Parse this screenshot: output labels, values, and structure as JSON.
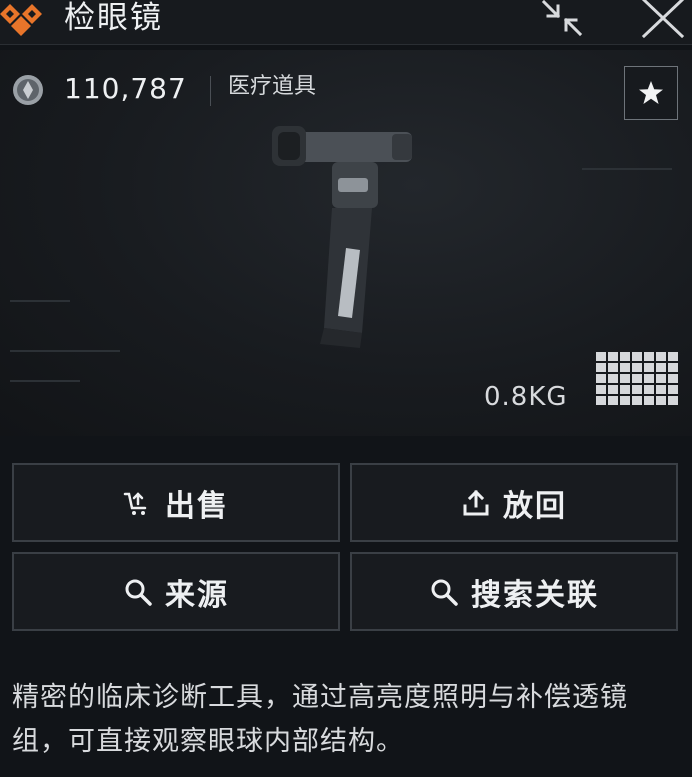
{
  "window": {
    "title": "检眼镜",
    "logo_icon": "brand-diamond-icon",
    "collapse_icon": "collapse-arrows-icon",
    "close_icon": "close-icon"
  },
  "item": {
    "price": "110,787",
    "category": "医疗道具",
    "weight": "0.8KG",
    "grid_size": {
      "cols": 7,
      "rows": 5
    }
  },
  "actions": {
    "sell_label": "出售",
    "store_label": "放回",
    "source_label": "来源",
    "search_related_label": "搜索关联"
  },
  "description": "精密的临床诊断工具，通过高亮度照明与补偿透镜组，可直接观察眼球内部结构。",
  "colors": {
    "accent_orange": "#e8752a",
    "background": "#111418",
    "button_border": "#3a3f45"
  }
}
